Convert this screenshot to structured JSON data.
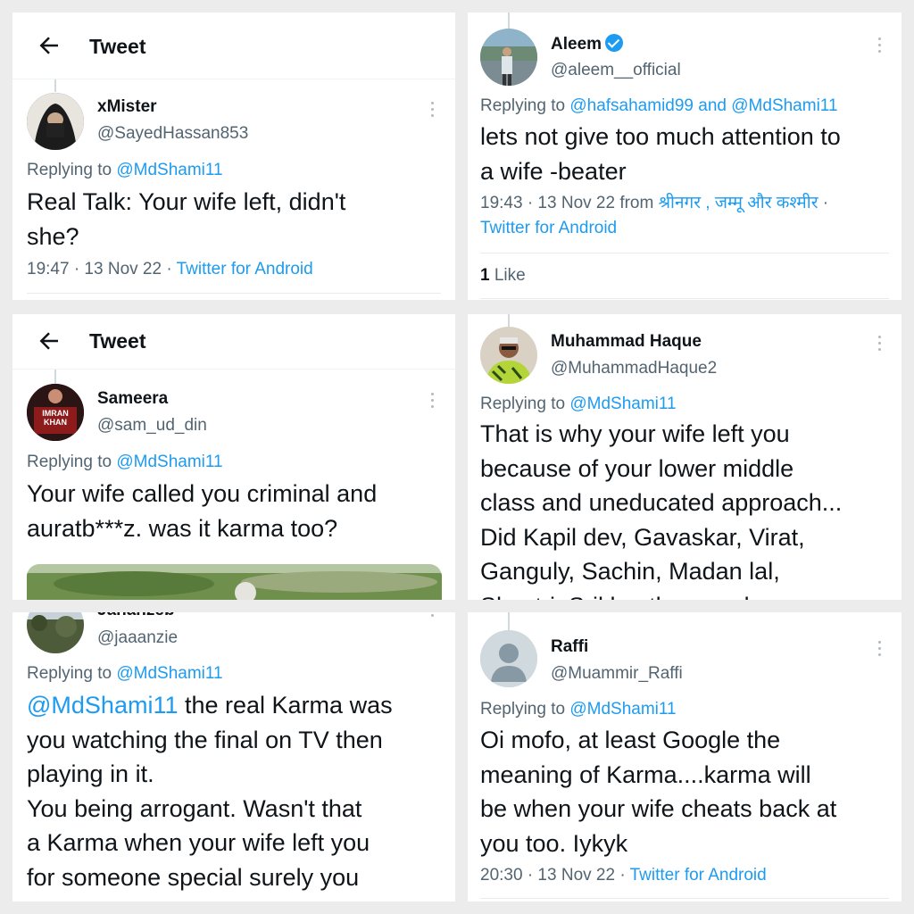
{
  "panel1": {
    "header_title": "Tweet",
    "name": "xMister",
    "handle": "@SayedHassan853",
    "replying_prefix": "Replying to",
    "replying_to": "@MdShami11",
    "text_line1": "Real Talk: Your wife left, didn't",
    "text_line2": "she?",
    "time": "19:47 · 13 Nov 22 · ",
    "source": "Twitter for Android"
  },
  "panel2": {
    "name": "Aleem",
    "handle": "@aleem__official",
    "replying_prefix": "Replying to",
    "replying_to1": "@hafsahamid99",
    "and": " and ",
    "replying_to2": "@MdShami11",
    "text_line1": "lets not give too much attention to",
    "text_line2": "a wife -beater",
    "time": "19:43 · 13 Nov 22 from ",
    "location": "श्रीनगर , जम्मू और कश्मीर",
    "dot": " ·",
    "source": "Twitter for Android",
    "likes_count": "1",
    "likes_label": " Like"
  },
  "panel3": {
    "header_title": "Tweet",
    "name": "Sameera",
    "handle": "@sam_ud_din",
    "avatar_text1": "IMRAN",
    "avatar_text2": "KHAN",
    "replying_prefix": "Replying to",
    "replying_to": "@MdShami11",
    "text_line1": "Your wife called you criminal and",
    "text_line2": "auratb***z. was it karma too?"
  },
  "panel4": {
    "name": "Muhammad Haque",
    "handle": "@MuhammadHaque2",
    "replying_prefix": "Replying to",
    "replying_to": "@MdShami11",
    "text_lines": [
      "That is why your wife left you",
      "because of your lower middle",
      "class and uneducated approach...",
      "Did Kapil dev, Gavaskar, Virat,",
      "Ganguly, Sachin, Madan lal,",
      "Shastri, Srikkanth, ever do a"
    ]
  },
  "panel5": {
    "name": "Jahanzeb",
    "handle": "@jaaanzie",
    "replying_prefix": "Replying to",
    "replying_to": "@MdShami11",
    "mention": "@MdShami11",
    "text_line1_rest": " the real Karma was",
    "text_lines": [
      "you watching the final on TV then",
      "playing in it.",
      "You being arrogant. Wasn't that",
      "a Karma when your wife left you",
      "for someone special surely you"
    ]
  },
  "panel6": {
    "name": "Raffi",
    "handle": "@Muammir_Raffi",
    "replying_prefix": "Replying to",
    "replying_to": "@MdShami11",
    "text_lines": [
      "Oi mofo, at least Google the",
      "meaning of Karma....karma will",
      "be when your wife cheats back at",
      "you too. Iykyk"
    ],
    "time": "20:30 · 13 Nov 22 · ",
    "source": "Twitter for Android"
  },
  "colors": {
    "accent": "#1d9bf0",
    "muted": "#536471",
    "text": "#0f1419"
  },
  "icons": [
    "back-arrow-icon",
    "more-options-icon",
    "verified-badge-icon",
    "default-avatar-icon"
  ]
}
